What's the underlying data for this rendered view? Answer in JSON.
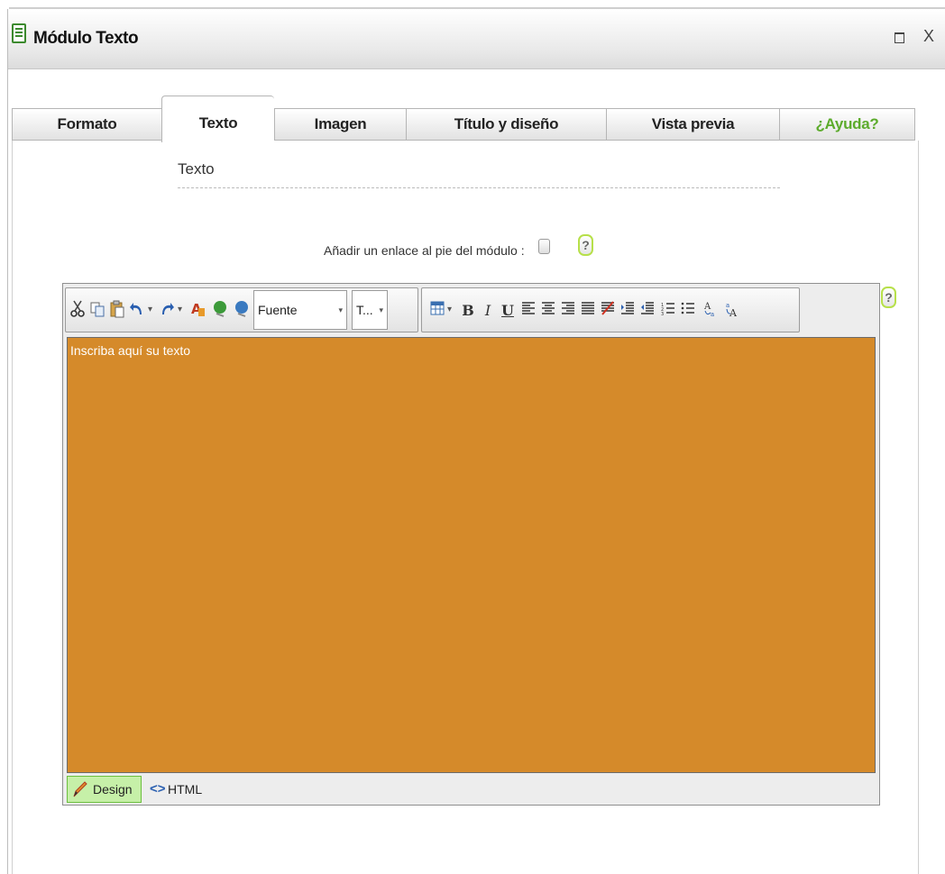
{
  "window": {
    "title": "Módulo Texto",
    "maximize_icon": "maximize-icon",
    "close_label": "X"
  },
  "tabs": [
    {
      "label": "Formato",
      "active": false
    },
    {
      "label": "Texto",
      "active": true
    },
    {
      "label": "Imagen",
      "active": false
    },
    {
      "label": "Título y diseño",
      "active": false
    },
    {
      "label": "Vista previa",
      "active": false
    },
    {
      "label": "¿Ayuda?",
      "active": false,
      "color": "#5cab2c"
    }
  ],
  "section": {
    "label": "Texto"
  },
  "link_option": {
    "label": "Añadir un enlace al pie del módulo :",
    "checked": false
  },
  "help": {
    "glyph": "?"
  },
  "toolbar": {
    "buttons": [
      {
        "name": "cut-icon"
      },
      {
        "name": "copy-icon"
      },
      {
        "name": "paste-icon"
      },
      {
        "name": "undo-icon"
      },
      {
        "name": "redo-icon"
      },
      {
        "name": "highlight-icon"
      },
      {
        "name": "insert-link-icon"
      },
      {
        "name": "remove-link-icon"
      },
      {
        "name": "table-icon"
      },
      {
        "name": "bold-icon",
        "label": "B"
      },
      {
        "name": "italic-icon",
        "label": "I"
      },
      {
        "name": "underline-icon",
        "label": "U"
      },
      {
        "name": "align-left-icon"
      },
      {
        "name": "align-center-icon"
      },
      {
        "name": "align-right-icon"
      },
      {
        "name": "align-justify-icon"
      },
      {
        "name": "clear-format-icon"
      },
      {
        "name": "indent-icon"
      },
      {
        "name": "outdent-icon"
      },
      {
        "name": "ordered-list-icon"
      },
      {
        "name": "bullet-list-icon"
      },
      {
        "name": "subscript-icon"
      },
      {
        "name": "superscript-icon"
      }
    ],
    "font_select": "Fuente",
    "size_select": "T..."
  },
  "editor": {
    "placeholder": "Inscriba aquí su texto",
    "background": "#d58a2a",
    "text_color": "#ffffff"
  },
  "modes": {
    "design": "Design",
    "html": "HTML",
    "active": "design"
  }
}
